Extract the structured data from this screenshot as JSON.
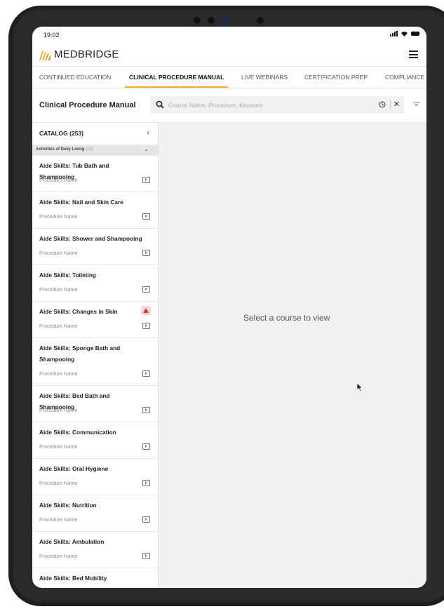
{
  "status": {
    "time": "19:02"
  },
  "header": {
    "logo_text": "MEDBRIDGE",
    "logo_icon": "medbridge-logo",
    "menu_icon": "hamburger-menu-icon"
  },
  "tabs": [
    {
      "label": "CONTINUED EDUCATION",
      "active": false
    },
    {
      "label": "CLINICAL PROCEDURE MANUAL",
      "active": true
    },
    {
      "label": "LIVE WEBINARS",
      "active": false
    },
    {
      "label": "CERTIFICATION PREP",
      "active": false
    },
    {
      "label": "COMPLIANCE",
      "active": false
    }
  ],
  "toolbar": {
    "title": "Clinical Procedure Manual",
    "search": {
      "placeholder": "Course Name, Procedure, Keyword",
      "value": ""
    },
    "icons": [
      "search-icon",
      "history-icon",
      "close-icon",
      "filter-icon"
    ]
  },
  "catalog": {
    "title": "CATALOG (253)",
    "section": {
      "label": "Activities of Daily Living",
      "count": "(15)"
    },
    "items": [
      {
        "title": "Aide Skills: Tub Bath and Shampooing",
        "sub": "Procedure Name",
        "warning": false
      },
      {
        "title": "Aide Skills: Nail and Skin Care",
        "sub": "Procedure Name",
        "warning": false
      },
      {
        "title": "Aide Skills: Shower and Shampooing",
        "sub": "Procedure Name",
        "warning": false
      },
      {
        "title": "Aide Skills: Toileting",
        "sub": "Procedure Name",
        "warning": false
      },
      {
        "title": "Aide Skills: Changes in Skin",
        "sub": "Procedure Name",
        "warning": true
      },
      {
        "title": "Aide Skills: Sponge Bath and Shampooing",
        "sub": "Procedure Name",
        "warning": false
      },
      {
        "title": "Aide Skills: Bed Bath and Shampooing",
        "sub": "Procedure Name",
        "warning": false
      },
      {
        "title": "Aide Skills: Communication",
        "sub": "Procedure Name",
        "warning": false
      },
      {
        "title": "Aide Skills: Oral Hygiene",
        "sub": "Procedure Name",
        "warning": false
      },
      {
        "title": "Aide Skills: Nutrition",
        "sub": "Procedure Name",
        "warning": false
      },
      {
        "title": "Aide Skills: Ambulation",
        "sub": "Procedure Name",
        "warning": false
      },
      {
        "title": "Aide Skills: Bed Mobility",
        "sub": "",
        "warning": false
      }
    ]
  },
  "content": {
    "empty_message": "Select a course to view"
  },
  "colors": {
    "accent": "#f0b233",
    "warning": "#d9352f",
    "panel_bg": "#f1f1f1"
  }
}
